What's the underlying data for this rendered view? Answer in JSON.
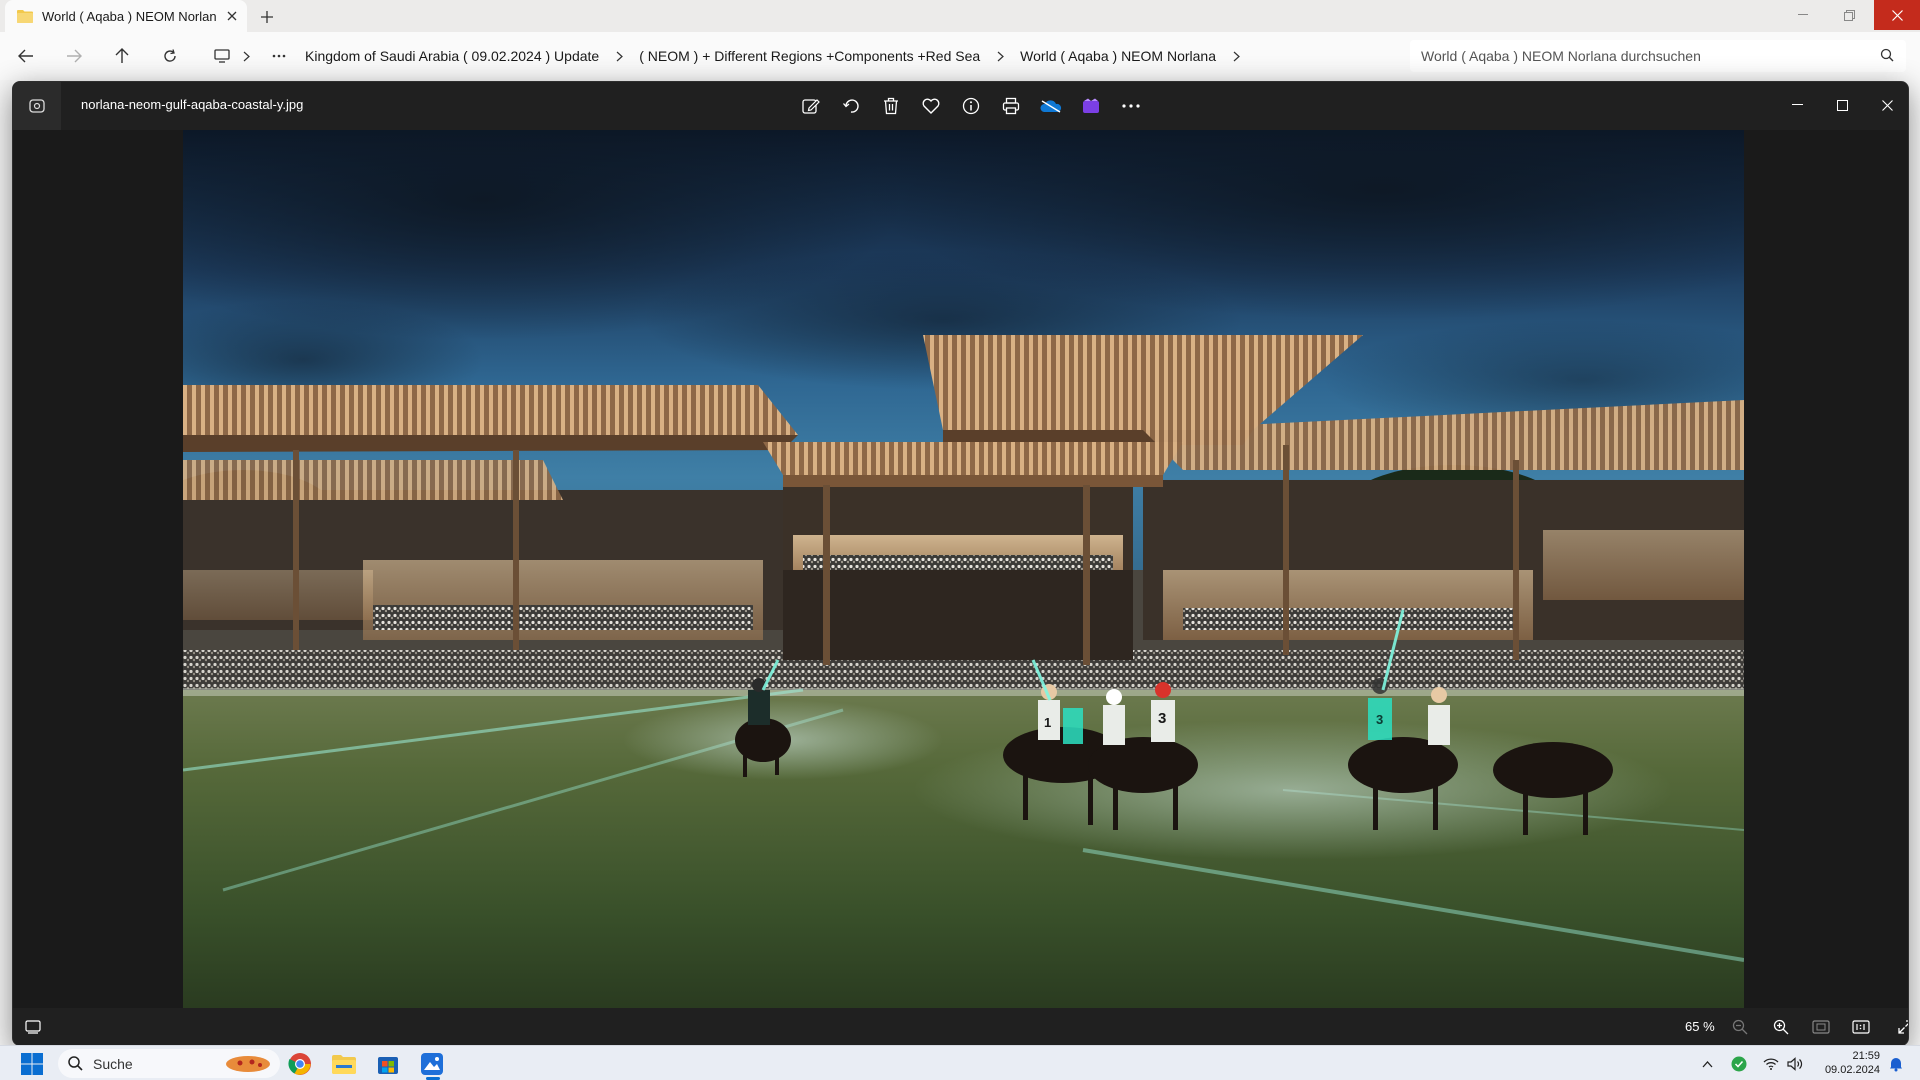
{
  "explorer": {
    "tab_title": "World ( Aqaba ) NEOM Norlan",
    "breadcrumbs": [
      "Kingdom of Saudi Arabia ( 09.02.2024 ) Update",
      "( NEOM ) + Different Regions +Components +Red Sea",
      "World ( Aqaba ) NEOM Norlana"
    ],
    "search_placeholder": "World ( Aqaba ) NEOM Norlana durchsuchen"
  },
  "viewer": {
    "filename": "norlana-neom-gulf-aqaba-coastal-y.jpg",
    "toolbar_icons": [
      "edit-image-icon",
      "rotate-icon",
      "delete-icon",
      "favorite-icon",
      "info-icon",
      "print-icon",
      "onedrive-icon",
      "clipchamp-icon",
      "more-icon"
    ],
    "zoom_label": "65 %",
    "photo_numbers": [
      "1",
      "3",
      "3"
    ]
  },
  "taskbar": {
    "search_label": "Suche",
    "time": "21:59",
    "date": "09.02.2024"
  },
  "colors": {
    "accent_close": "#c42b1c",
    "viewer_bg": "#1f1f1f",
    "taskbar_bg": "#e9edf4"
  }
}
